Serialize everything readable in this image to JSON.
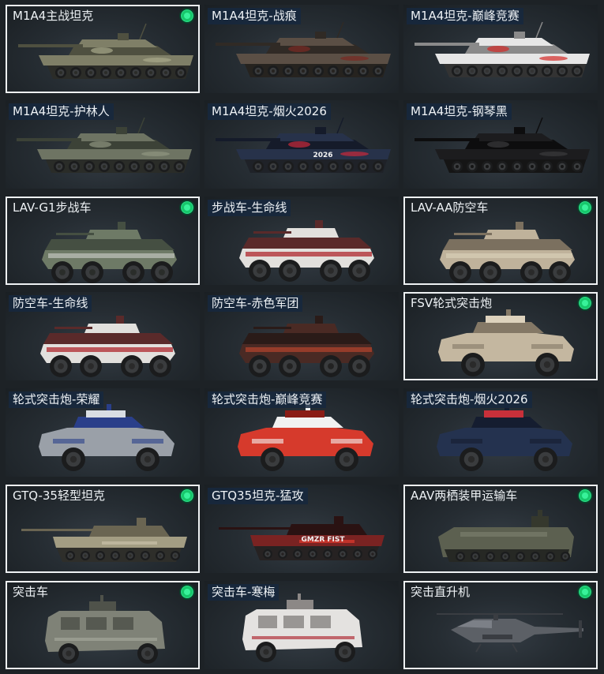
{
  "vehicles": [
    {
      "name": "M1A4主战坦克",
      "type": "tank",
      "scheme": "desert",
      "owned": true,
      "selected": true,
      "label_bg": false
    },
    {
      "name": "M1A4坦克-战痕",
      "type": "tank",
      "scheme": "scarred",
      "owned": false,
      "selected": false,
      "label_bg": true
    },
    {
      "name": "M1A4坦克-巅峰竞赛",
      "type": "tank",
      "scheme": "peak",
      "owned": false,
      "selected": false,
      "label_bg": true
    },
    {
      "name": "M1A4坦克-护林人",
      "type": "tank",
      "scheme": "forest",
      "owned": false,
      "selected": false,
      "label_bg": true
    },
    {
      "name": "M1A4坦克-烟火2026",
      "type": "tank",
      "scheme": "fireworks",
      "owned": false,
      "selected": false,
      "label_bg": true,
      "decal": "2026"
    },
    {
      "name": "M1A4坦克-钢琴黑",
      "type": "tank",
      "scheme": "black",
      "owned": false,
      "selected": false,
      "label_bg": true
    },
    {
      "name": "LAV-G1步战车",
      "type": "ifv",
      "scheme": "green",
      "owned": true,
      "selected": true,
      "label_bg": false
    },
    {
      "name": "步战车-生命线",
      "type": "ifv",
      "scheme": "lifeline",
      "owned": false,
      "selected": false,
      "label_bg": true
    },
    {
      "name": "LAV-AA防空车",
      "type": "ifv",
      "scheme": "tan",
      "owned": true,
      "selected": true,
      "label_bg": false
    },
    {
      "name": "防空车-生命线",
      "type": "ifv",
      "scheme": "lifeline",
      "owned": false,
      "selected": false,
      "label_bg": true
    },
    {
      "name": "防空车-赤色军团",
      "type": "ifv",
      "scheme": "redcamo",
      "owned": false,
      "selected": false,
      "label_bg": true
    },
    {
      "name": "FSV轮式突击炮",
      "type": "fsv",
      "scheme": "sand",
      "owned": true,
      "selected": true,
      "label_bg": false
    },
    {
      "name": "轮式突击炮-荣耀",
      "type": "fsv",
      "scheme": "glory",
      "owned": false,
      "selected": false,
      "label_bg": true
    },
    {
      "name": "轮式突击炮-巅峰竞赛",
      "type": "fsv",
      "scheme": "peakred",
      "owned": false,
      "selected": false,
      "label_bg": true
    },
    {
      "name": "轮式突击炮-烟火2026",
      "type": "fsv",
      "scheme": "navy",
      "owned": false,
      "selected": false,
      "label_bg": true
    },
    {
      "name": "GTQ-35轻型坦克",
      "type": "light",
      "scheme": "khaki",
      "owned": true,
      "selected": true,
      "label_bg": false
    },
    {
      "name": "GTQ35坦克-猛攻",
      "type": "light",
      "scheme": "assault",
      "owned": false,
      "selected": false,
      "label_bg": true,
      "decal": "GMZR FIST"
    },
    {
      "name": "AAV两栖装甲运输车",
      "type": "aav",
      "scheme": "olive",
      "owned": true,
      "selected": true,
      "label_bg": false
    },
    {
      "name": "突击车",
      "type": "mrap",
      "scheme": "grey",
      "owned": true,
      "selected": true,
      "label_bg": false
    },
    {
      "name": "突击车-寒梅",
      "type": "mrap",
      "scheme": "plum",
      "owned": false,
      "selected": false,
      "label_bg": true
    },
    {
      "name": "突击直升机",
      "type": "heli",
      "scheme": "heli",
      "owned": true,
      "selected": true,
      "label_bg": false
    }
  ],
  "colors": {
    "owned_indicator": "#17c76b",
    "selected_border": "#eef1f3",
    "label_bg": "#16283e",
    "schemes": {
      "desert": {
        "body": "#7f7f67",
        "dark": "#4f5040",
        "accent": "#a8a88a",
        "track": "#2b2c28"
      },
      "scarred": {
        "body": "#5b4f45",
        "dark": "#302a25",
        "accent": "#7a2a22",
        "track": "#26231f"
      },
      "peak": {
        "body": "#e6e6e6",
        "dark": "#8a8a8a",
        "accent": "#d42a26",
        "track": "#333333"
      },
      "forest": {
        "body": "#6e7463",
        "dark": "#3c4237",
        "accent": "#8f9580",
        "track": "#2a2c28"
      },
      "fireworks": {
        "body": "#27324a",
        "dark": "#151b2a",
        "accent": "#c9283b",
        "track": "#1f2228"
      },
      "black": {
        "body": "#1c1c1e",
        "dark": "#0d0d0e",
        "accent": "#3a3a3c",
        "track": "#151515"
      },
      "green": {
        "body": "#6e7a66",
        "dark": "#454f42",
        "accent": "#b7bcb3",
        "track": "#2a2d2a"
      },
      "lifeline": {
        "body": "#e2e0dd",
        "dark": "#5a2a2a",
        "accent": "#b3333a",
        "track": "#2a2a2a"
      },
      "tan": {
        "body": "#bfb29b",
        "dark": "#7b705f",
        "accent": "#d5cab3",
        "track": "#2a2a2a"
      },
      "redcamo": {
        "body": "#4a2a24",
        "dark": "#2a1b18",
        "accent": "#a8412c",
        "track": "#222"
      },
      "sand": {
        "body": "#c4b7a0",
        "dark": "#847866",
        "accent": "#ddd2bd",
        "track": "#2a2a2a"
      },
      "glory": {
        "body": "#9aa0a8",
        "dark": "#2a3f8a",
        "accent": "#d8dde3",
        "track": "#2a2a2a"
      },
      "peakred": {
        "body": "#d63a2c",
        "dark": "#f1f1f1",
        "accent": "#8a1c16",
        "track": "#2a2a2a"
      },
      "navy": {
        "body": "#24324f",
        "dark": "#151d30",
        "accent": "#c8303a",
        "track": "#2a2a2a"
      },
      "khaki": {
        "body": "#a39d83",
        "dark": "#6a6552",
        "accent": "#c7c1a8",
        "track": "#2e2e2a"
      },
      "assault": {
        "body": "#7a2322",
        "dark": "#2a1212",
        "accent": "#e23a2e",
        "track": "#262222"
      },
      "olive": {
        "body": "#5c6050",
        "dark": "#35382d",
        "accent": "#7d8270",
        "track": "#262824"
      },
      "grey": {
        "body": "#7f8277",
        "dark": "#4f524a",
        "accent": "#a2a59a",
        "track": "#2a2a2a"
      },
      "plum": {
        "body": "#e4e2e0",
        "dark": "#8c8886",
        "accent": "#b2323a",
        "track": "#2a2a2a"
      },
      "heli": {
        "body": "#5c6066",
        "dark": "#3a3d42",
        "accent": "#8a8f96",
        "track": "#2a2a2a"
      }
    }
  }
}
